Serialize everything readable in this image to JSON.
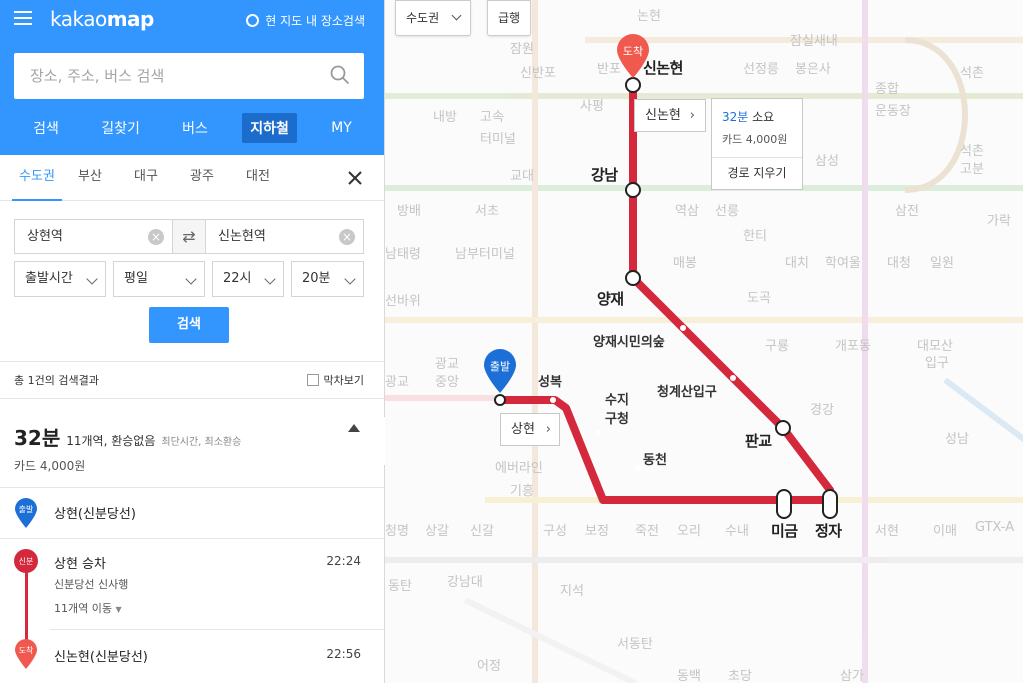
{
  "header": {
    "logo_light": "kakao",
    "logo_bold": "map",
    "nearby_search": "현 지도 내 장소검색",
    "search_placeholder": "장소, 주소, 버스 검색"
  },
  "main_tabs": [
    {
      "label": "검색",
      "active": false
    },
    {
      "label": "길찾기",
      "active": false
    },
    {
      "label": "버스",
      "active": false
    },
    {
      "label": "지하철",
      "active": true
    },
    {
      "label": "MY",
      "active": false
    }
  ],
  "regions": [
    {
      "label": "수도권",
      "active": true
    },
    {
      "label": "부산",
      "active": false
    },
    {
      "label": "대구",
      "active": false
    },
    {
      "label": "광주",
      "active": false
    },
    {
      "label": "대전",
      "active": false
    }
  ],
  "route": {
    "origin": "상현역",
    "destination": "신논현역"
  },
  "options": {
    "time_type": "출발시간",
    "day_type": "평일",
    "hour": "22시",
    "minute": "20분"
  },
  "search_button": "검색",
  "results": {
    "total": "총 1건의 검색결과",
    "last_train": "막차보기",
    "duration": "32분",
    "summary": "11개역, 환승없음",
    "criteria": "최단시간, 최소환승",
    "fare": "카드 4,000원"
  },
  "steps": {
    "start_badge": "출발",
    "start_station": "상현(신분당선)",
    "line_badge": "신분",
    "board": "상현 승차",
    "board_time": "22:24",
    "direction": "신분당선 신사행",
    "move": "11개역 이동",
    "arrive_badge": "도착",
    "arrive_station": "신논현(신분당선)",
    "arrive_time": "22:56"
  },
  "map": {
    "region_select": "수도권",
    "express_btn": "급행",
    "dest_popup_btn": "신논현",
    "time_popup_minutes": "32분",
    "time_popup_suffix": "소요",
    "time_popup_fare": "카드 4,000원",
    "clear_route": "경로 지우기",
    "origin_popup_btn": "상현",
    "pin_start": "출발",
    "pin_end": "도착",
    "route_color": "#d4283c",
    "stations": {
      "sinnonhyeon": "신논현",
      "gangnam": "강남",
      "yangjae": "양재",
      "yangjae_forest": "양재시민의숲",
      "cheonggyesan": "청계산입구",
      "pangyo": "판교",
      "jeongja": "정자",
      "migeum": "미금",
      "dongcheon": "동천",
      "suji_line1": "수지",
      "suji_line2": "구청",
      "seongbok": "성복",
      "sanghyeon": "상현"
    },
    "bg_labels": [
      "논현",
      "잠원",
      "신반포",
      "반포",
      "사평",
      "선정릉",
      "봉은사",
      "잠실새내",
      "종합",
      "운동장",
      "석촌",
      "내방",
      "고속",
      "터미널",
      "교대",
      "삼성",
      "석촌",
      "고분",
      "방배",
      "서초",
      "역삼",
      "선릉",
      "삼전",
      "가락",
      "남태령",
      "남부터미널",
      "매봉",
      "한티",
      "대치",
      "학여울",
      "대청",
      "일원",
      "선바위",
      "도곡",
      "구룡",
      "개포동",
      "대모산",
      "입구",
      "광교",
      "중앙",
      "광교",
      "경강",
      "성남",
      "에버라인",
      "기흥",
      "청명",
      "상갈",
      "신갈",
      "구성",
      "보정",
      "죽전",
      "오리",
      "수내",
      "서현",
      "이매",
      "GTX-A",
      "동탄",
      "강남대",
      "지석",
      "서동탄",
      "어정",
      "동백",
      "초당",
      "삼가"
    ]
  }
}
